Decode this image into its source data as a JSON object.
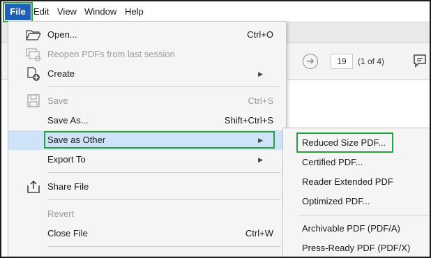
{
  "menubar": {
    "items": [
      "File",
      "Edit",
      "View",
      "Window",
      "Help"
    ]
  },
  "toolbar": {
    "page_number": "19",
    "page_count": "(1 of 4)"
  },
  "file_menu": {
    "items": [
      {
        "label": "Open...",
        "shortcut": "Ctrl+O",
        "icon": "folder-open-icon",
        "enabled": true
      },
      {
        "label": "Reopen PDFs from last session",
        "shortcut": "",
        "icon": "reopen-icon",
        "enabled": false
      },
      {
        "label": "Create",
        "shortcut": "",
        "icon": "create-pdf-icon",
        "submenu": true,
        "enabled": true
      },
      {
        "label": "Save",
        "shortcut": "Ctrl+S",
        "icon": "save-icon",
        "enabled": false
      },
      {
        "label": "Save As...",
        "shortcut": "Shift+Ctrl+S",
        "icon": "",
        "enabled": true
      },
      {
        "label": "Save as Other",
        "shortcut": "",
        "icon": "",
        "submenu": true,
        "enabled": true,
        "highlighted": true
      },
      {
        "label": "Export To",
        "shortcut": "",
        "icon": "",
        "submenu": true,
        "enabled": true
      },
      {
        "label": "Share File",
        "shortcut": "",
        "icon": "share-icon",
        "enabled": true
      },
      {
        "label": "Revert",
        "shortcut": "",
        "icon": "",
        "enabled": false
      },
      {
        "label": "Close File",
        "shortcut": "Ctrl+W",
        "icon": "",
        "enabled": true
      }
    ]
  },
  "save_as_other_submenu": {
    "items": [
      {
        "label": "Reduced Size PDF...",
        "highlighted": true
      },
      {
        "label": "Certified PDF..."
      },
      {
        "label": "Reader Extended PDF"
      },
      {
        "label": "Optimized PDF..."
      },
      {
        "label": "Archivable PDF (PDF/A)"
      },
      {
        "label": "Press-Ready PDF (PDF/X)"
      }
    ]
  },
  "colors": {
    "file_menu_active": "#1e61b8",
    "highlight_outline": "#23a23f",
    "hover_row": "#cfe3f8",
    "menu_bg": "#f5f5f5"
  }
}
